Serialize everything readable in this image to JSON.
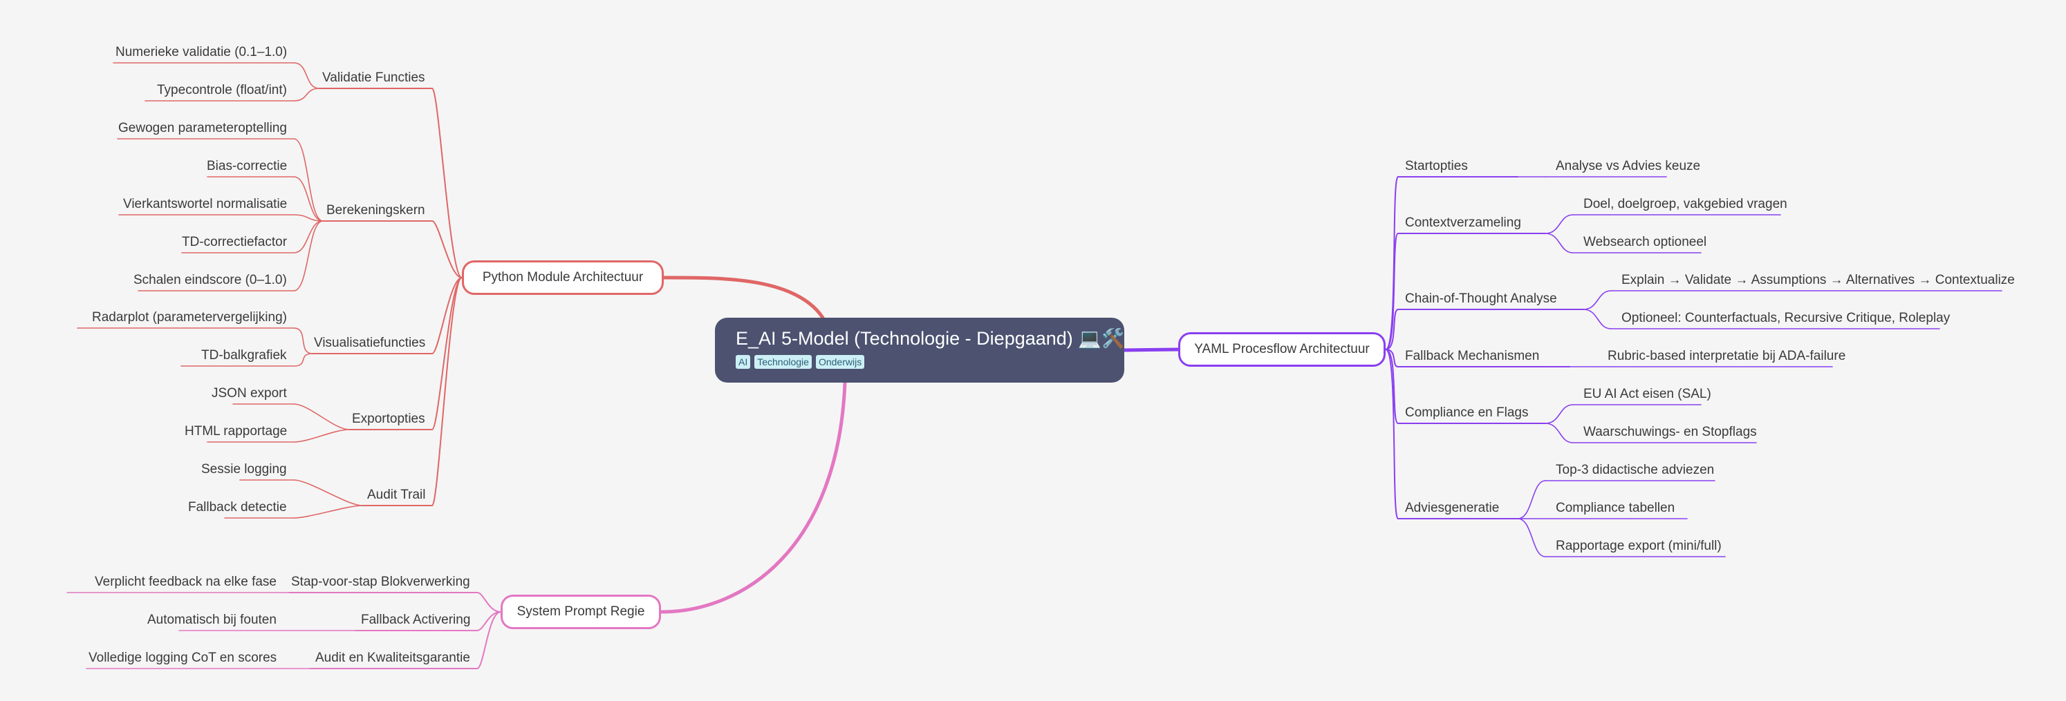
{
  "root": {
    "title": "E_AI 5-Model (Technologie - Diepgaand) 💻🛠️",
    "tags": [
      "AI",
      "Technologie",
      "Onderwijs"
    ],
    "color": "#4c5270"
  },
  "branches": [
    {
      "key": "python",
      "label": "Python Module Architectuur",
      "color": "#e06666",
      "children": [
        {
          "label": "Validatie Functies",
          "children": [
            "Numerieke validatie (0.1–1.0)",
            "Typecontrole (float/int)"
          ]
        },
        {
          "label": "Berekeningskern",
          "children": [
            "Gewogen parameteroptelling",
            "Bias-correctie",
            "Vierkantswortel normalisatie",
            "TD-correctiefactor",
            "Schalen eindscore (0–1.0)"
          ]
        },
        {
          "label": "Visualisatiefuncties",
          "children": [
            "Radarplot (parametervergelijking)",
            "TD-balkgrafiek"
          ]
        },
        {
          "label": "Exportopties",
          "children": [
            "JSON export",
            "HTML rapportage"
          ]
        },
        {
          "label": "Audit Trail",
          "children": [
            "Sessie logging",
            "Fallback detectie"
          ]
        }
      ]
    },
    {
      "key": "system",
      "label": "System Prompt Regie",
      "color": "#e377c2",
      "children": [
        {
          "label": "Stap-voor-stap Blokverwerking",
          "children": [
            "Verplicht feedback na elke fase"
          ]
        },
        {
          "label": "Fallback Activering",
          "children": [
            "Automatisch bij fouten"
          ]
        },
        {
          "label": "Audit en Kwaliteitsgarantie",
          "children": [
            "Volledige logging CoT en scores"
          ]
        }
      ]
    },
    {
      "key": "yaml",
      "label": "YAML Procesflow Architectuur",
      "color": "#8a3ff0",
      "children": [
        {
          "label": "Startopties",
          "children": [
            "Analyse vs Advies keuze"
          ]
        },
        {
          "label": "Contextverzameling",
          "children": [
            "Doel, doelgroep, vakgebied vragen",
            "Websearch optioneel"
          ]
        },
        {
          "label": "Chain-of-Thought Analyse",
          "children": [
            "Explain → Validate → Assumptions → Alternatives → Contextualize",
            "Optioneel: Counterfactuals, Recursive Critique, Roleplay"
          ]
        },
        {
          "label": "Fallback Mechanismen",
          "children": [
            "Rubric-based interpretatie bij ADA-failure"
          ]
        },
        {
          "label": "Compliance en Flags",
          "children": [
            "EU AI Act eisen (SAL)",
            "Waarschuwings- en Stopflags"
          ]
        },
        {
          "label": "Adviesgeneratie",
          "children": [
            "Top-3 didactische adviezen",
            "Compliance tabellen",
            "Rapportage export (mini/full)"
          ]
        }
      ]
    }
  ]
}
